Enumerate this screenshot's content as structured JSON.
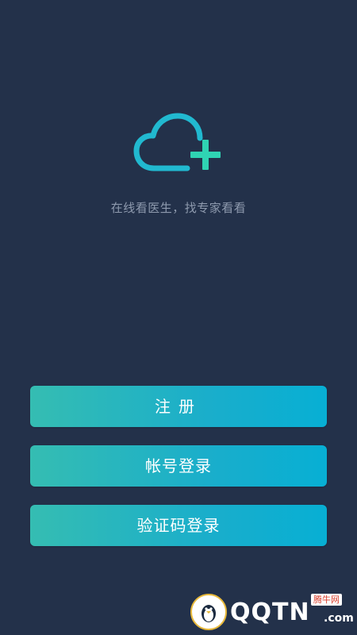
{
  "app": {
    "tagline": "在线看医生，找专家看看"
  },
  "logo": {
    "icon": "cloud-plus-icon",
    "cloud_color": "#21b9d0",
    "plus_color": "#2fd3b3"
  },
  "buttons": {
    "register_label": "注册",
    "account_login_label": "帐号登录",
    "sms_login_label": "验证码登录"
  },
  "watermark": {
    "brand": "QQTN",
    "domain": ".com",
    "badge": "腾牛网",
    "icon": "qqtn-penguin-logo-icon"
  },
  "colors": {
    "background": "#23314a",
    "button_gradient_start": "#35bdb2",
    "button_gradient_end": "#07afd4",
    "tagline_text": "#8e9aae"
  }
}
